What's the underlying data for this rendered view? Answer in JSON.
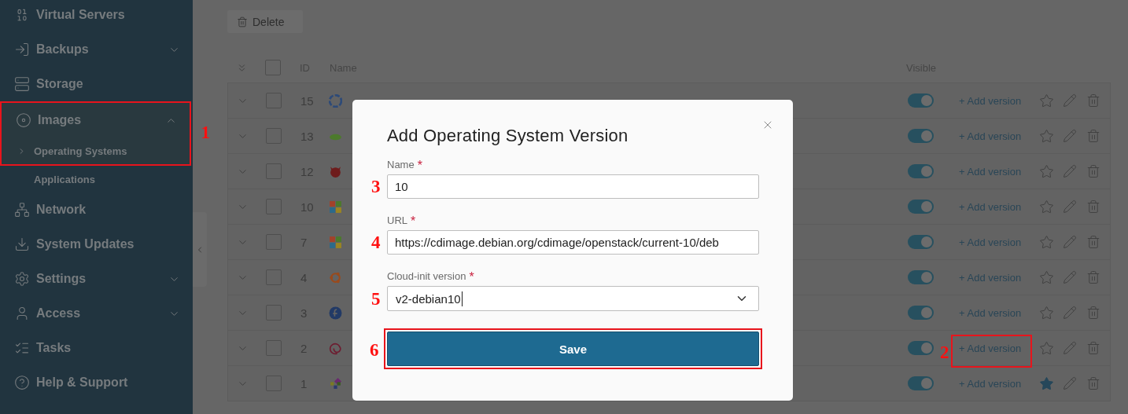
{
  "sidebar": {
    "items": [
      {
        "label": "Virtual Servers"
      },
      {
        "label": "Backups",
        "expanded": false
      },
      {
        "label": "Storage"
      },
      {
        "label": "Images",
        "expanded": true,
        "callout": "1",
        "children": [
          {
            "label": "Operating Systems",
            "selected": true
          },
          {
            "label": "Applications",
            "selected": false
          }
        ]
      },
      {
        "label": "Network"
      },
      {
        "label": "System Updates"
      },
      {
        "label": "Settings",
        "expanded": false
      },
      {
        "label": "Access",
        "expanded": false
      },
      {
        "label": "Tasks"
      },
      {
        "label": "Help & Support"
      }
    ]
  },
  "toolbar": {
    "delete_button": "Delete"
  },
  "table": {
    "columns": [
      "ID",
      "Name",
      "Visible"
    ],
    "all_checked": false,
    "rows": [
      {
        "id": "15",
        "kind": "swirl",
        "checked": false,
        "visible": true,
        "action": "+ Add version",
        "favorite": false
      },
      {
        "id": "13",
        "kind": "lizard",
        "checked": false,
        "visible": true,
        "action": "+ Add version",
        "favorite": false
      },
      {
        "id": "12",
        "kind": "devil",
        "checked": false,
        "visible": true,
        "action": "+ Add version",
        "favorite": false
      },
      {
        "id": "10",
        "kind": "squares",
        "checked": false,
        "visible": true,
        "action": "+ Add version",
        "favorite": false
      },
      {
        "id": "7",
        "kind": "squares",
        "checked": false,
        "visible": true,
        "action": "+ Add version",
        "favorite": false
      },
      {
        "id": "4",
        "kind": "ring",
        "checked": false,
        "visible": true,
        "action": "+ Add version",
        "favorite": false
      },
      {
        "id": "3",
        "kind": "bubble",
        "checked": false,
        "visible": true,
        "action": "+ Add version",
        "favorite": false
      },
      {
        "id": "2",
        "kind": "spiral",
        "checked": false,
        "visible": true,
        "action": "+ Add version",
        "favorite": false,
        "callout": "2"
      },
      {
        "id": "1",
        "kind": "pinwheel",
        "checked": false,
        "visible": true,
        "action": "+ Add version",
        "favorite": true
      }
    ]
  },
  "modal": {
    "title": "Add Operating System Version",
    "fields": [
      {
        "label": "Name",
        "required": "*",
        "kind": "text",
        "value": "10",
        "callout": "3"
      },
      {
        "label": "URL",
        "required": "*",
        "kind": "text",
        "value": "https://cdimage.debian.org/cdimage/openstack/current-10/deb",
        "callout": "4"
      },
      {
        "label": "Cloud-init version",
        "required": "*",
        "kind": "select",
        "value": "v2-debian10",
        "callout": "5"
      }
    ],
    "save_button": {
      "label": "Save",
      "callout": "6"
    }
  }
}
